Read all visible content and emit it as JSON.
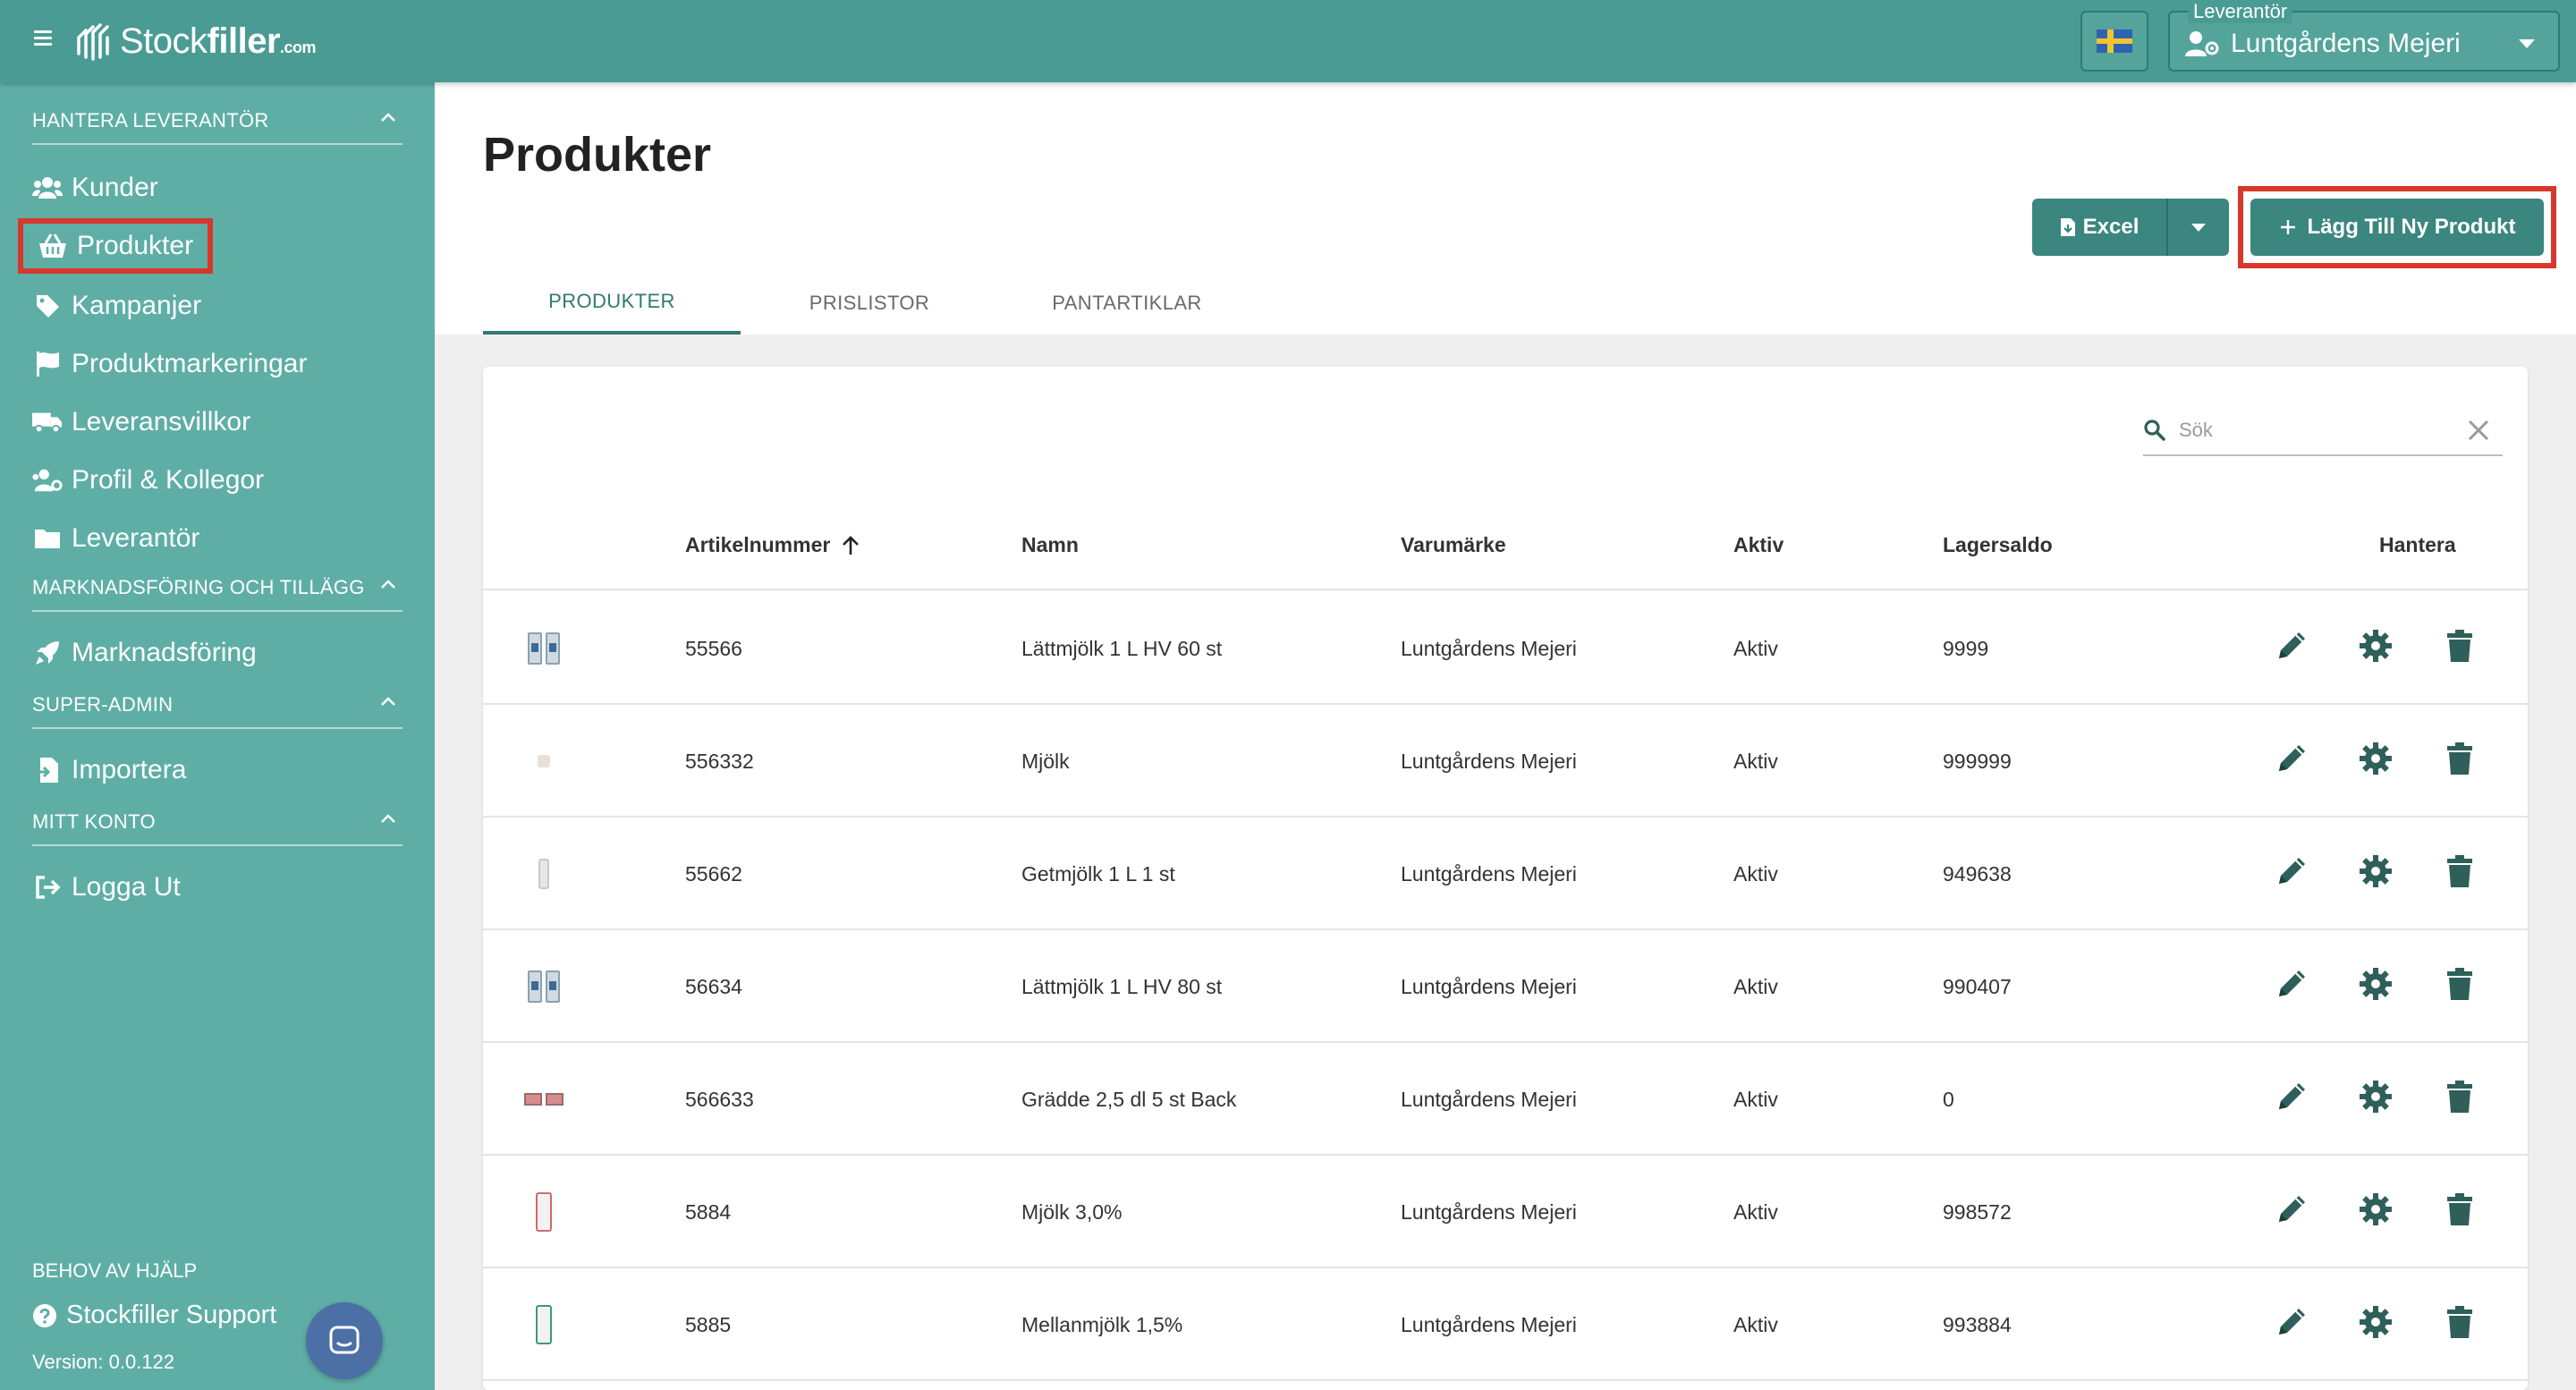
{
  "brand": {
    "name_plain": "Stock",
    "name_bold": "filler",
    "suffix": ".com"
  },
  "topbar": {
    "supplier_legend": "Leverantör",
    "supplier_value": "Luntgårdens Mejeri"
  },
  "sidebar": {
    "sections": [
      {
        "title": "HANTERA LEVERANTÖR"
      },
      {
        "title": "MARKNADSFÖRING OCH TILLÄGG"
      },
      {
        "title": "SUPER-ADMIN"
      },
      {
        "title": "MITT KONTO"
      }
    ],
    "items": [
      {
        "label": "Kunder",
        "icon": "users-icon"
      },
      {
        "label": "Produkter",
        "icon": "basket-icon"
      },
      {
        "label": "Kampanjer",
        "icon": "tag-icon"
      },
      {
        "label": "Produktmarkeringar",
        "icon": "flag-icon"
      },
      {
        "label": "Leveransvillkor",
        "icon": "truck-icon"
      },
      {
        "label": "Profil & Kollegor",
        "icon": "users-cog-icon"
      },
      {
        "label": "Leverantör",
        "icon": "folder-icon"
      },
      {
        "label": "Marknadsföring",
        "icon": "rocket-icon"
      },
      {
        "label": "Importera",
        "icon": "file-import-icon"
      },
      {
        "label": "Logga Ut",
        "icon": "sign-out-icon"
      }
    ],
    "help_label": "BEHOV AV HJÄLP",
    "support_label": "Stockfiller Support",
    "version": "Version: 0.0.122"
  },
  "main": {
    "title": "Produkter",
    "excel_label": "Excel",
    "add_label": "Lägg Till Ny Produkt",
    "tabs": [
      {
        "label": "PRODUKTER",
        "active": true
      },
      {
        "label": "PRISLISTOR",
        "active": false
      },
      {
        "label": "PANTARTIKLAR",
        "active": false
      }
    ],
    "search": {
      "placeholder": "Sök",
      "value": ""
    },
    "columns": {
      "article": "Artikelnummer",
      "name": "Namn",
      "brand": "Varumärke",
      "active": "Aktiv",
      "stock": "Lagersaldo",
      "manage": "Hantera"
    },
    "rows": [
      {
        "article": "55566",
        "name": "Lättmjölk 1 L HV 60 st",
        "brand": "Luntgårdens Mejeri",
        "active": "Aktiv",
        "stock": "9999"
      },
      {
        "article": "556332",
        "name": "Mjölk",
        "brand": "Luntgårdens Mejeri",
        "active": "Aktiv",
        "stock": "999999"
      },
      {
        "article": "55662",
        "name": "Getmjölk 1 L 1 st",
        "brand": "Luntgårdens Mejeri",
        "active": "Aktiv",
        "stock": "949638"
      },
      {
        "article": "56634",
        "name": "Lättmjölk 1 L HV 80 st",
        "brand": "Luntgårdens Mejeri",
        "active": "Aktiv",
        "stock": "990407"
      },
      {
        "article": "566633",
        "name": "Grädde 2,5 dl 5 st Back",
        "brand": "Luntgårdens Mejeri",
        "active": "Aktiv",
        "stock": "0"
      },
      {
        "article": "5884",
        "name": "Mjölk 3,0%",
        "brand": "Luntgårdens Mejeri",
        "active": "Aktiv",
        "stock": "998572"
      },
      {
        "article": "5885",
        "name": "Mellanmjölk 1,5%",
        "brand": "Luntgårdens Mejeri",
        "active": "Aktiv",
        "stock": "993884"
      }
    ]
  },
  "colors": {
    "topbar": "#4a9b93",
    "sidebar": "#5eaea6",
    "accent": "#3b867e",
    "action_icon": "#2f5f5a",
    "highlight": "#d8372c"
  }
}
